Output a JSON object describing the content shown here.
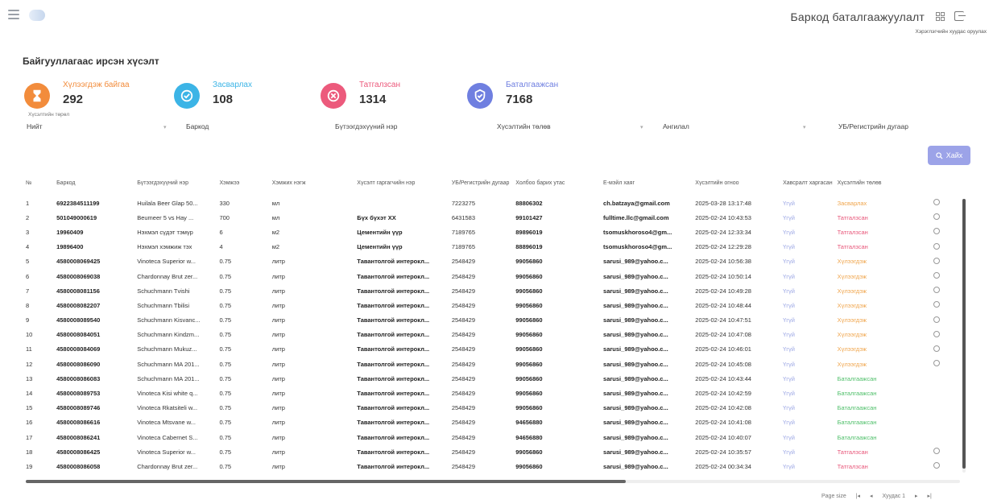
{
  "header": {
    "app_title": "Баркод баталгаажуулалт",
    "app_subtitle": "Хэрэглэгчийн хуудас оруулах"
  },
  "page": {
    "title": "Байгууллагаас ирсэн хүсэлт"
  },
  "stats": [
    {
      "label": "Хүлээгдэж байгаа",
      "value": "292",
      "color": "#f28c3c",
      "icon": "hourglass-icon"
    },
    {
      "label": "Засварлах",
      "value": "108",
      "color": "#3cb4e6",
      "icon": "check-circle-icon"
    },
    {
      "label": "Татгалзсан",
      "value": "1314",
      "color": "#ec5a7c",
      "icon": "close-icon"
    },
    {
      "label": "Баталгаажсан",
      "value": "7168",
      "color": "#6f7fe0",
      "icon": "shield-check-icon"
    }
  ],
  "filters": {
    "caption": "Хүсэлтийн төрөл",
    "items": [
      "Нийт",
      "Баркод",
      "Бүтээгдэхүүний нэр",
      "Хүсэлтийн төлөв",
      "Ангилал",
      "УБ/Регистрийн дугаар"
    ]
  },
  "search_button": "Хайх",
  "table": {
    "headers": [
      "№",
      "Баркод",
      "Бүтээгдэхүүний нэр",
      "Хэмжээ",
      "Хэмжих нэгж",
      "Хүсэлт гаргагчийн нэр",
      "УБ/Регистрийн дугаар",
      "Холбоо барих утас",
      "Е-мэйл хаяг",
      "Хүсэлтийн огноо",
      "Хавсралт харгасан",
      "Хүсэлтийн төлөв",
      ""
    ],
    "rows": [
      [
        "1",
        "6922384511199",
        "Huilala Beer Glap 50...",
        "330",
        "мл",
        "",
        "7223275",
        "88806302",
        "ch.batzaya@gmail.com",
        "2025-03-28 13:17:48",
        "Үгүй",
        "Засварлах",
        "o"
      ],
      [
        "2",
        "501049000619",
        "Beumeer 5 vs Hay ...",
        "700",
        "мл",
        "Бүх бүхэт ХХ",
        "6431583",
        "99101427",
        "fulltime.llc@gmail.com",
        "2025-02-24 10:43:53",
        "Үгүй",
        "Татгалзсан",
        "o"
      ],
      [
        "3",
        "19960409",
        "Нэхмэл сүдэт тэмүр",
        "6",
        "м2",
        "Цементийн үүр",
        "7189765",
        "89896019",
        "tsomuskhoroso4@gm...",
        "2025-02-24 12:33:34",
        "Үгүй",
        "Татгалзсан",
        "o"
      ],
      [
        "4",
        "19896400",
        "Нэхмэл хэмжиж тэх",
        "4",
        "м2",
        "Цементийн үүр",
        "7189765",
        "88896019",
        "tsomuskhoroso4@gm...",
        "2025-02-24 12:29:28",
        "Үгүй",
        "Татгалзсан",
        "o"
      ],
      [
        "5",
        "4580008069425",
        "Vinoteca Superior w...",
        "0.75",
        "литр",
        "Тавантолгой интерокл...",
        "2548429",
        "99056860",
        "sarusi_989@yahoo.c...",
        "2025-02-24 10:56:38",
        "Үгүй",
        "Хүлээгдэж",
        "o"
      ],
      [
        "6",
        "4580008069038",
        "Chardonnay Brut zer...",
        "0.75",
        "литр",
        "Тавантолгой интерокл...",
        "2548429",
        "99056860",
        "sarusi_989@yahoo.c...",
        "2025-02-24 10:50:14",
        "Үгүй",
        "Хүлээгдэж",
        "o"
      ],
      [
        "7",
        "4580008081156",
        "Schuchmann Tvishi",
        "0.75",
        "литр",
        "Тавантолгой интерокл...",
        "2548429",
        "99056860",
        "sarusi_989@yahoo.c...",
        "2025-02-24 10:49:28",
        "Үгүй",
        "Хүлээгдэж",
        "o"
      ],
      [
        "8",
        "4580008082207",
        "Schuchmann Tbilisi",
        "0.75",
        "литр",
        "Тавантолгой интерокл...",
        "2548429",
        "99056860",
        "sarusi_989@yahoo.c...",
        "2025-02-24 10:48:44",
        "Үгүй",
        "Хүлээгдэж",
        "o"
      ],
      [
        "9",
        "4580008089540",
        "Schuchmann Kisvanc...",
        "0.75",
        "литр",
        "Тавантолгой интерокл...",
        "2548429",
        "99056860",
        "sarusi_989@yahoo.c...",
        "2025-02-24 10:47:51",
        "Үгүй",
        "Хүлээгдэж",
        "o"
      ],
      [
        "10",
        "4580008084051",
        "Schuchmann Kindzm...",
        "0.75",
        "литр",
        "Тавантолгой интерокл...",
        "2548429",
        "99056860",
        "sarusi_989@yahoo.c...",
        "2025-02-24 10:47:08",
        "Үгүй",
        "Хүлээгдэж",
        "o"
      ],
      [
        "11",
        "4580008084069",
        "Schuchmann Mukuz...",
        "0.75",
        "литр",
        "Тавантолгой интерокл...",
        "2548429",
        "99056860",
        "sarusi_989@yahoo.c...",
        "2025-02-24 10:46:01",
        "Үгүй",
        "Хүлээгдэж",
        "o"
      ],
      [
        "12",
        "4580008086090",
        "Schuchmann MA 201...",
        "0.75",
        "литр",
        "Тавантолгой интерокл...",
        "2548429",
        "99056860",
        "sarusi_989@yahoo.c...",
        "2025-02-24 10:45:08",
        "Үгүй",
        "Хүлээгдэж",
        "o"
      ],
      [
        "13",
        "4580008086083",
        "Schuchmann MA 201...",
        "0.75",
        "литр",
        "Тавантолгой интерокл...",
        "2548429",
        "99056860",
        "sarusi_989@yahoo.c...",
        "2025-02-24 10:43:44",
        "Үгүй",
        "Баталгаажсан",
        ""
      ],
      [
        "14",
        "4580008089753",
        "Vinoteca Kisi white q...",
        "0.75",
        "литр",
        "Тавантолгой интерокл...",
        "2548429",
        "99056860",
        "sarusi_989@yahoo.c...",
        "2025-02-24 10:42:59",
        "Үгүй",
        "Баталгаажсан",
        ""
      ],
      [
        "15",
        "4580008089746",
        "Vinoteca Rkatsiteli w...",
        "0.75",
        "литр",
        "Тавантолгой интерокл...",
        "2548429",
        "99056860",
        "sarusi_989@yahoo.c...",
        "2025-02-24 10:42:08",
        "Үгүй",
        "Баталгаажсан",
        ""
      ],
      [
        "16",
        "4580008086616",
        "Vinoteca Mtsvane w...",
        "0.75",
        "литр",
        "Тавантолгой интерокл...",
        "2548429",
        "94656880",
        "sarusi_989@yahoo.c...",
        "2025-02-24 10:41:08",
        "Үгүй",
        "Баталгаажсан",
        ""
      ],
      [
        "17",
        "4580008086241",
        "Vinoteca Cabernet S...",
        "0.75",
        "литр",
        "Тавантолгой интерокл...",
        "2548429",
        "94656880",
        "sarusi_989@yahoo.c...",
        "2025-02-24 10:40:07",
        "Үгүй",
        "Баталгаажсан",
        ""
      ],
      [
        "18",
        "4580008086425",
        "Vinoteca Superior w...",
        "0.75",
        "литр",
        "Тавантолгой интерокл...",
        "2548429",
        "99056860",
        "sarusi_989@yahoo.c...",
        "2025-02-24 10:35:57",
        "Үгүй",
        "Татгалзсан",
        "o"
      ],
      [
        "19",
        "4580008086058",
        "Chardonnay Brut zer...",
        "0.75",
        "литр",
        "Тавантолгой интерокл...",
        "2548429",
        "99056860",
        "sarusi_989@yahoo.c...",
        "2025-02-24 00:34:34",
        "Үгүй",
        "Татгалзсан",
        "o"
      ]
    ]
  },
  "pager": {
    "rows_per_page": "Page size",
    "page_info": "Хуудас 1"
  }
}
